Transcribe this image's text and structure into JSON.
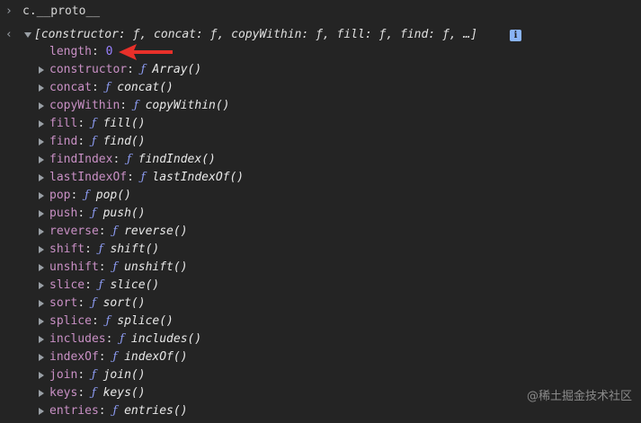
{
  "console": {
    "input_prompt": "›",
    "input_command": "c.__proto__",
    "result_prompt": "‹",
    "summary": "[constructor: ƒ, concat: ƒ, copyWithin: ƒ, fill: ƒ, find: ƒ, …]",
    "info_badge": "i",
    "length_key": "length",
    "length_value": "0",
    "props": [
      {
        "key": "constructor",
        "fn": "Array()"
      },
      {
        "key": "concat",
        "fn": "concat()"
      },
      {
        "key": "copyWithin",
        "fn": "copyWithin()"
      },
      {
        "key": "fill",
        "fn": "fill()"
      },
      {
        "key": "find",
        "fn": "find()"
      },
      {
        "key": "findIndex",
        "fn": "findIndex()"
      },
      {
        "key": "lastIndexOf",
        "fn": "lastIndexOf()"
      },
      {
        "key": "pop",
        "fn": "pop()"
      },
      {
        "key": "push",
        "fn": "push()"
      },
      {
        "key": "reverse",
        "fn": "reverse()"
      },
      {
        "key": "shift",
        "fn": "shift()"
      },
      {
        "key": "unshift",
        "fn": "unshift()"
      },
      {
        "key": "slice",
        "fn": "slice()"
      },
      {
        "key": "sort",
        "fn": "sort()"
      },
      {
        "key": "splice",
        "fn": "splice()"
      },
      {
        "key": "includes",
        "fn": "includes()"
      },
      {
        "key": "indexOf",
        "fn": "indexOf()"
      },
      {
        "key": "join",
        "fn": "join()"
      },
      {
        "key": "keys",
        "fn": "keys()"
      },
      {
        "key": "entries",
        "fn": "entries()"
      }
    ],
    "f_glyph": "ƒ",
    "colon": ":"
  },
  "watermark": "@稀土掘金技术社区",
  "colors": {
    "background": "#242424",
    "key": "#c990c5",
    "function_glyph": "#8d9cf3",
    "number": "#9980ff",
    "arrow": "#e8302a"
  }
}
